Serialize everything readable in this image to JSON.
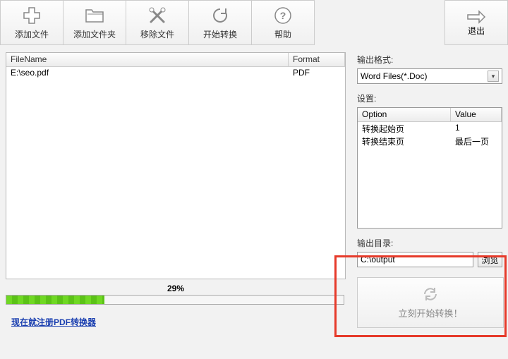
{
  "toolbar": {
    "add_file": "添加文件",
    "add_folder": "添加文件夹",
    "remove_file": "移除文件",
    "start_convert": "开始转换",
    "help": "帮助",
    "exit": "退出"
  },
  "file_table": {
    "headers": {
      "filename": "FileName",
      "format": "Format"
    },
    "rows": [
      {
        "filename": "E:\\seo.pdf",
        "format": "PDF"
      }
    ]
  },
  "output_format": {
    "label": "输出格式:",
    "value": "Word Files(*.Doc)"
  },
  "settings": {
    "label": "设置:",
    "headers": {
      "option": "Option",
      "value": "Value"
    },
    "rows": [
      {
        "option": "转换起始页",
        "value": "1"
      },
      {
        "option": "转换结束页",
        "value": "最后一页"
      }
    ]
  },
  "output_dir": {
    "label": "输出目录:",
    "value": "C:\\output",
    "browse": "浏览"
  },
  "convert_now": "立刻开始转换！",
  "progress": {
    "percent": 29,
    "text": "29%"
  },
  "register_link": "现在就注册PDF转换器"
}
